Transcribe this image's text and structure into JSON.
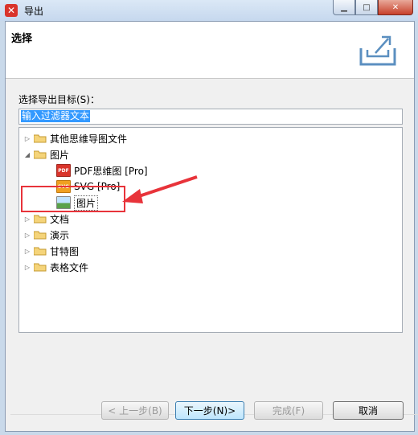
{
  "window": {
    "title": "导出",
    "app_icon": "xmind-icon"
  },
  "header": {
    "title": "选择",
    "icon": "export-icon"
  },
  "target": {
    "label": "选择导出目标(S)：",
    "filter_placeholder": "输入过滤器文本"
  },
  "tree": {
    "items": [
      {
        "label": "其他思维导图文件",
        "type": "folder",
        "expanded": false
      },
      {
        "label": "图片",
        "type": "folder",
        "expanded": true
      },
      {
        "label": "PDF思维图 [Pro]",
        "type": "pdf"
      },
      {
        "label": "SVG [Pro]",
        "type": "svg"
      },
      {
        "label": "图片",
        "type": "image",
        "selected": true
      },
      {
        "label": "文档",
        "type": "folder",
        "expanded": false
      },
      {
        "label": "演示",
        "type": "folder",
        "expanded": false
      },
      {
        "label": "甘特图",
        "type": "folder",
        "expanded": false
      },
      {
        "label": "表格文件",
        "type": "folder",
        "expanded": false
      }
    ]
  },
  "buttons": {
    "back": "< 上一步(B)",
    "next": "下一步(N)>",
    "finish": "完成(F)",
    "cancel": "取消"
  },
  "colors": {
    "accent_red": "#e8333a",
    "selection_blue": "#3399ff"
  }
}
